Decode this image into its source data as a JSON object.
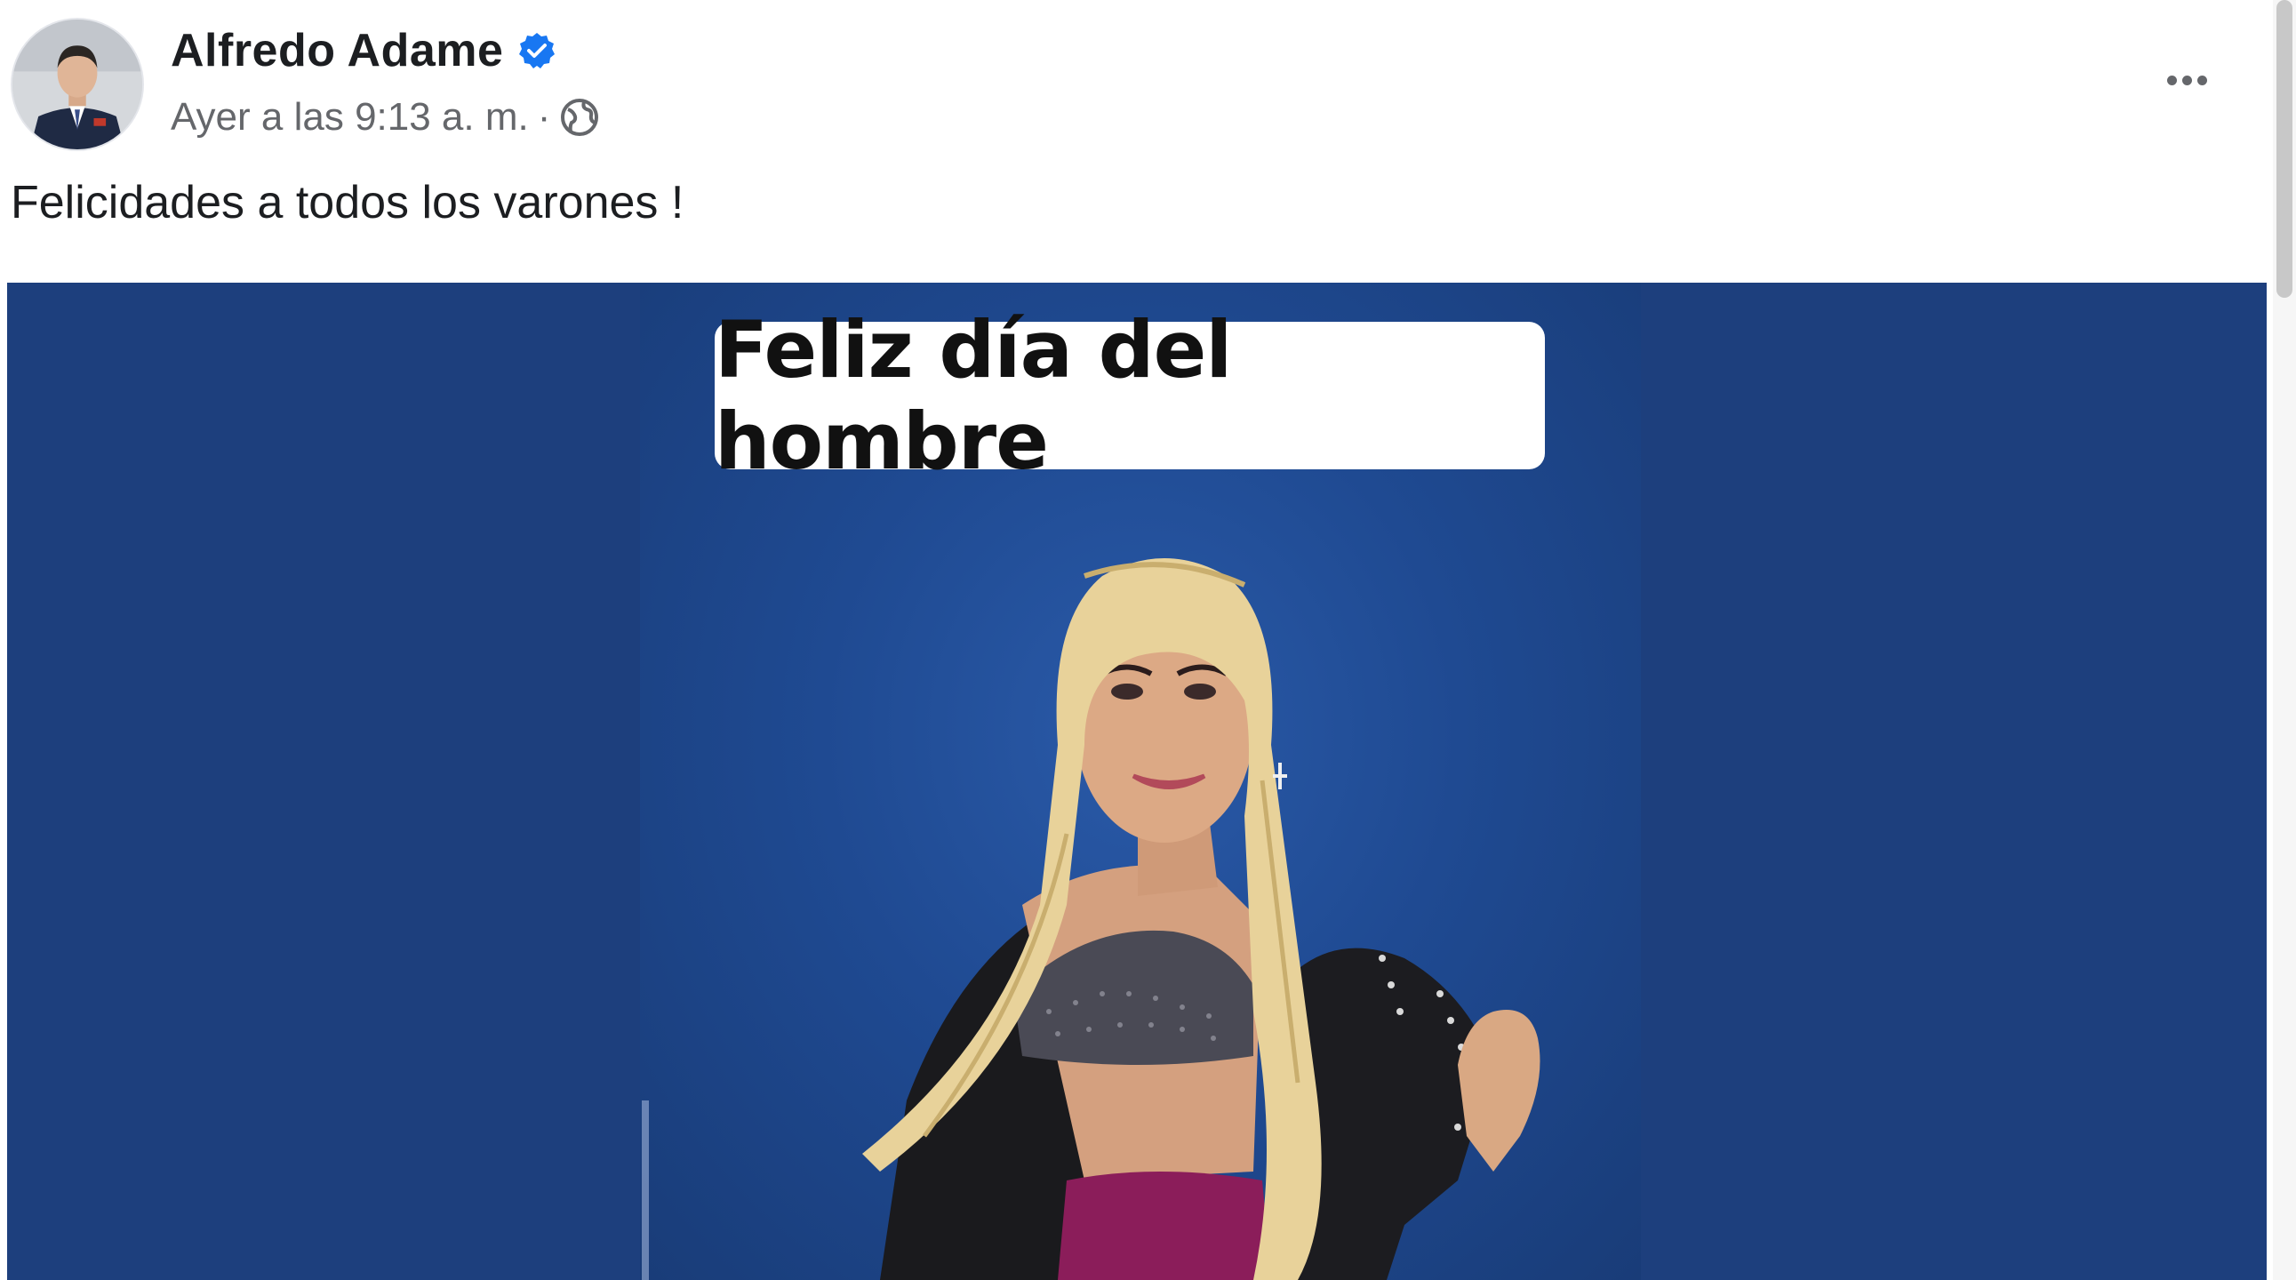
{
  "post": {
    "author": {
      "name": "Alfredo Adame",
      "verified": true,
      "avatar_icon": "profile-photo"
    },
    "meta": {
      "timestamp": "Ayer a las 9:13 a. m.",
      "separator": "·",
      "audience_icon": "globe-icon"
    },
    "menu_icon": "more-options-icon",
    "caption": "Felicidades a todos los varones !",
    "image": {
      "overlay_text": "Feliz día del hombre"
    }
  },
  "colors": {
    "verified_badge": "#1877f2",
    "media_background": "#1d3f7d",
    "secondary_text": "#65676b",
    "primary_text": "#1c1e21"
  }
}
